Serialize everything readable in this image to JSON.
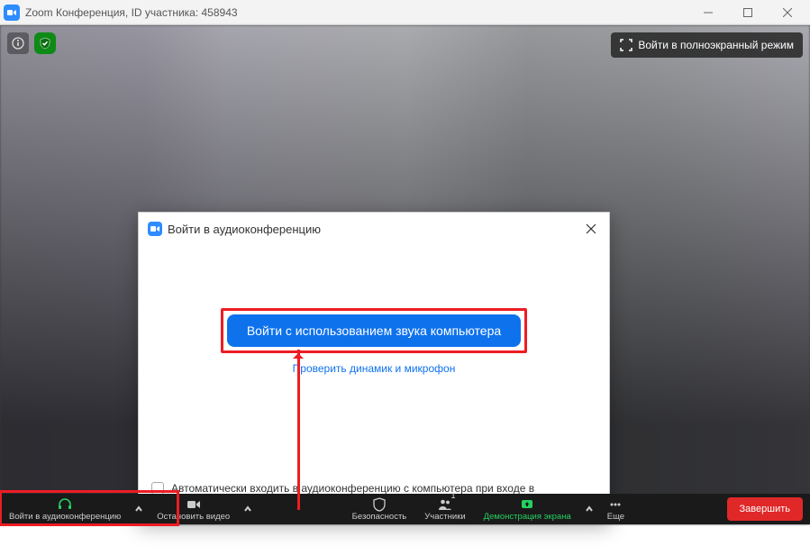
{
  "titlebar": {
    "text": "Zoom Конференция, ID участника: 458943"
  },
  "fullscreen": {
    "label": "Войти в полноэкранный режим"
  },
  "modal": {
    "title": "Войти в аудиоконференцию",
    "join_button": "Войти с использованием звука компьютера",
    "test_link": "Проверить динамик и микрофон",
    "auto_join_label": "Автоматически входить в аудиоконференцию с компьютера при входе в конференцию"
  },
  "bottombar": {
    "audio": "Войти в аудиоконференцию",
    "video": "Остановить видео",
    "security": "Безопасность",
    "participants": "Участники",
    "participants_count": "1",
    "share": "Демонстрация экрана",
    "more": "Еще",
    "end": "Завершить"
  }
}
